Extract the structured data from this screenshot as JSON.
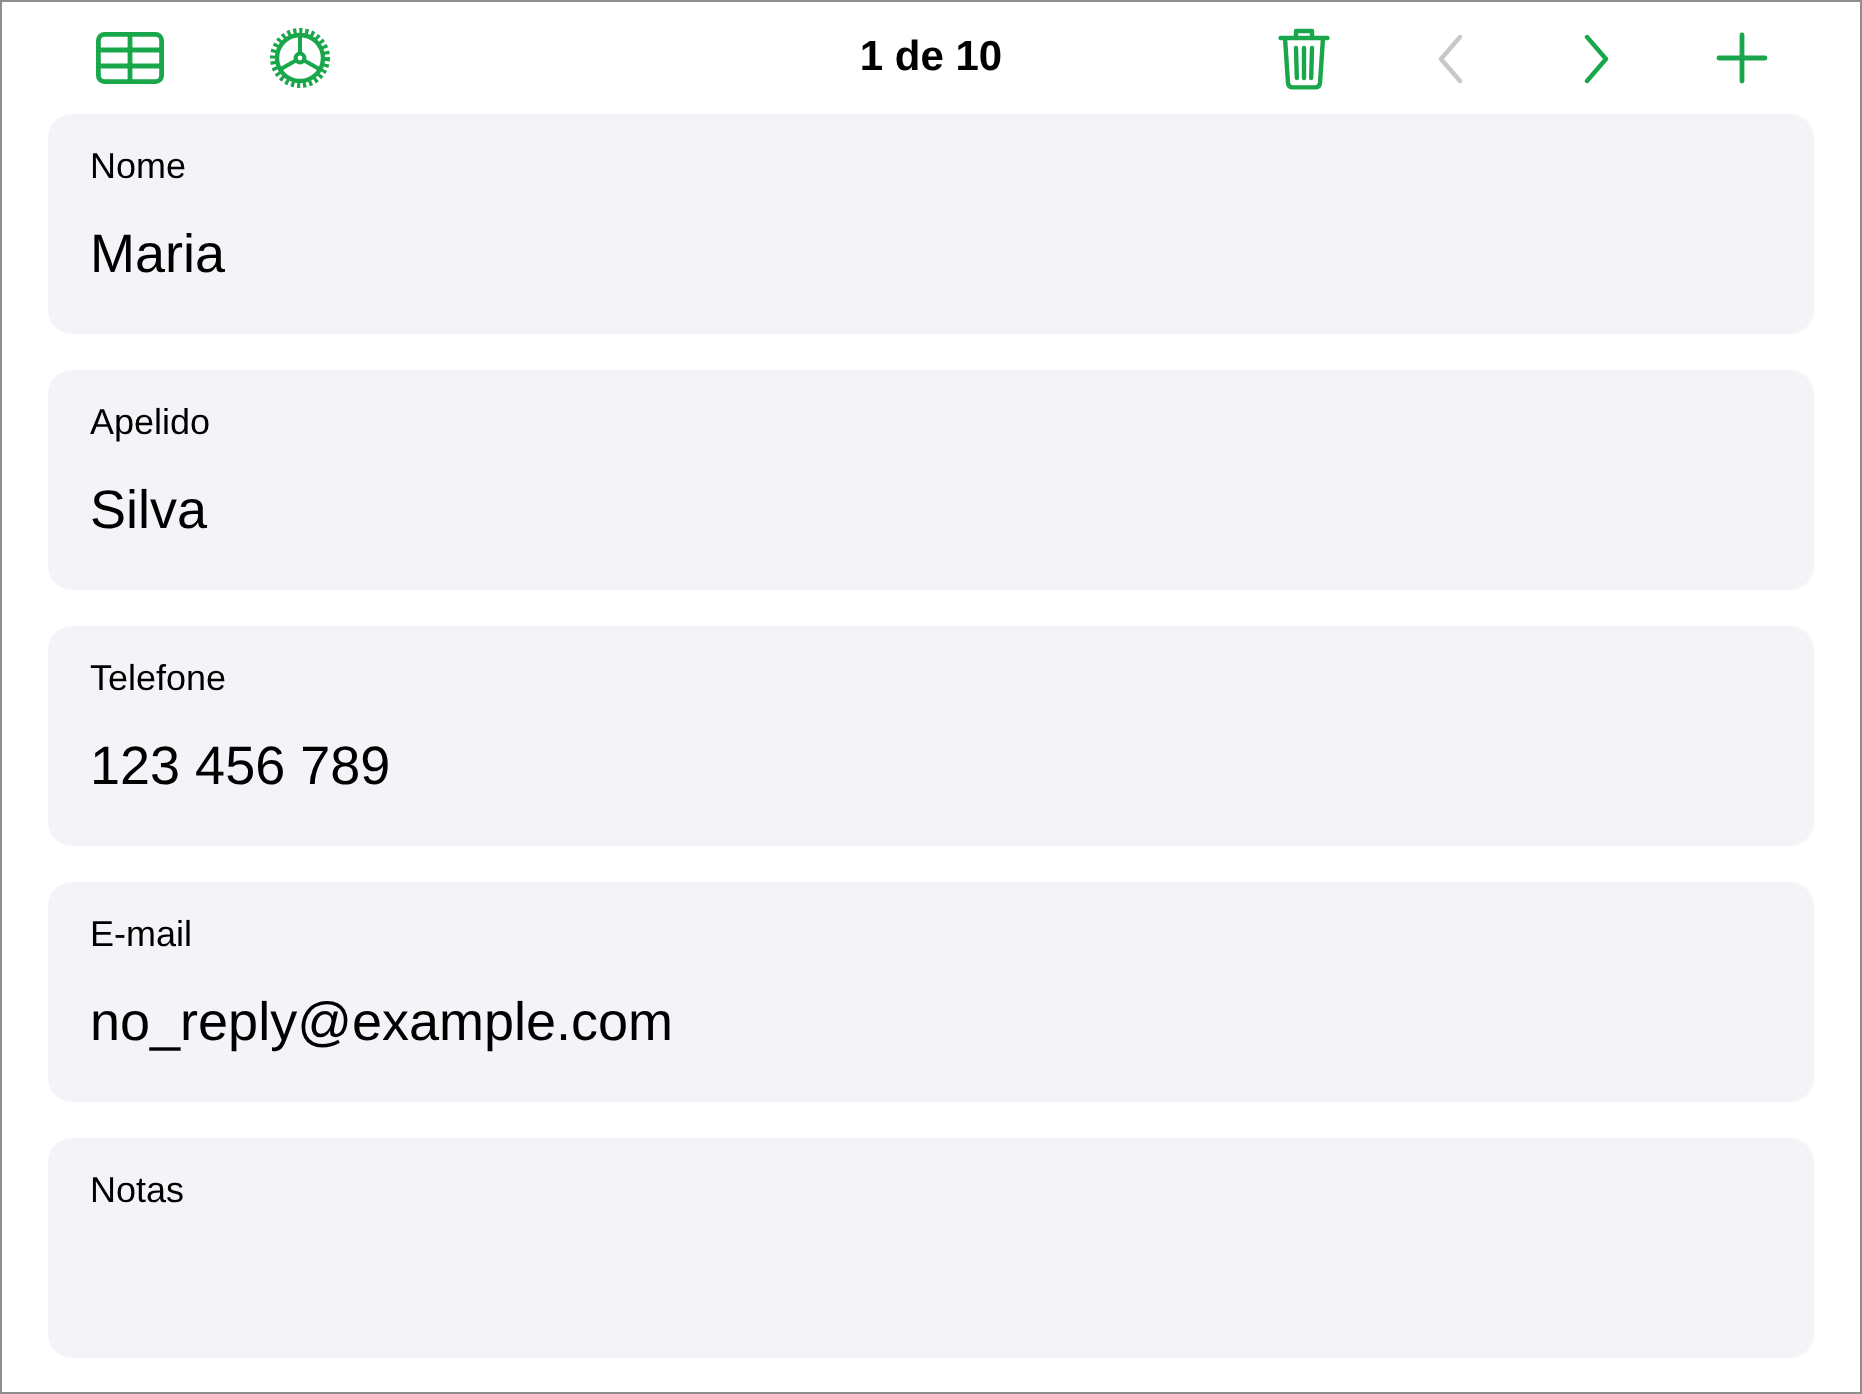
{
  "toolbar": {
    "title": "1 de 10",
    "navigation": [
      {
        "kind": "previous",
        "disabled": true
      },
      {
        "kind": "next",
        "disabled": false
      }
    ]
  },
  "fields": [
    {
      "label": "Nome",
      "value": "Maria"
    },
    {
      "label": "Apelido",
      "value": "Silva"
    },
    {
      "label": "Telefone",
      "value": "123 456 789"
    },
    {
      "label": "E-mail",
      "value": "no_reply@example.com"
    },
    {
      "label": "Notas"
    }
  ]
}
